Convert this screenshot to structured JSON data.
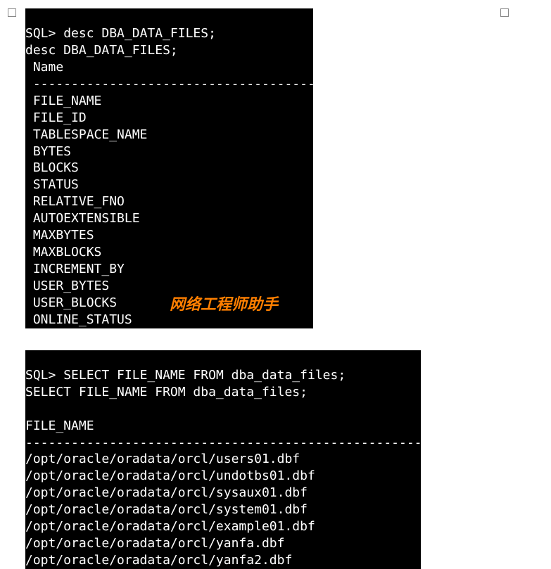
{
  "terminal1": {
    "prompt": "SQL>",
    "command": "desc DBA_DATA_FILES;",
    "echo": "desc DBA_DATA_FILES;",
    "header": " Name",
    "divider": " -----------------------------------------",
    "columns": [
      " FILE_NAME",
      " FILE_ID",
      " TABLESPACE_NAME",
      " BYTES",
      " BLOCKS",
      " STATUS",
      " RELATIVE_FNO",
      " AUTOEXTENSIBLE",
      " MAXBYTES",
      " MAXBLOCKS",
      " INCREMENT_BY",
      " USER_BYTES",
      " USER_BLOCKS",
      " ONLINE_STATUS"
    ],
    "watermark": "网络工程师助手"
  },
  "terminal2": {
    "prompt": "SQL>",
    "command": "SELECT FILE_NAME FROM dba_data_files;",
    "echo": "SELECT FILE_NAME FROM dba_data_files;",
    "header": "FILE_NAME",
    "divider": "--------------------------------------------------------",
    "rows": [
      "/opt/oracle/oradata/orcl/users01.dbf",
      "/opt/oracle/oradata/orcl/undotbs01.dbf",
      "/opt/oracle/oradata/orcl/sysaux01.dbf",
      "/opt/oracle/oradata/orcl/system01.dbf",
      "/opt/oracle/oradata/orcl/example01.dbf",
      "/opt/oracle/oradata/orcl/yanfa.dbf",
      "/opt/oracle/oradata/orcl/yanfa2.dbf"
    ]
  }
}
